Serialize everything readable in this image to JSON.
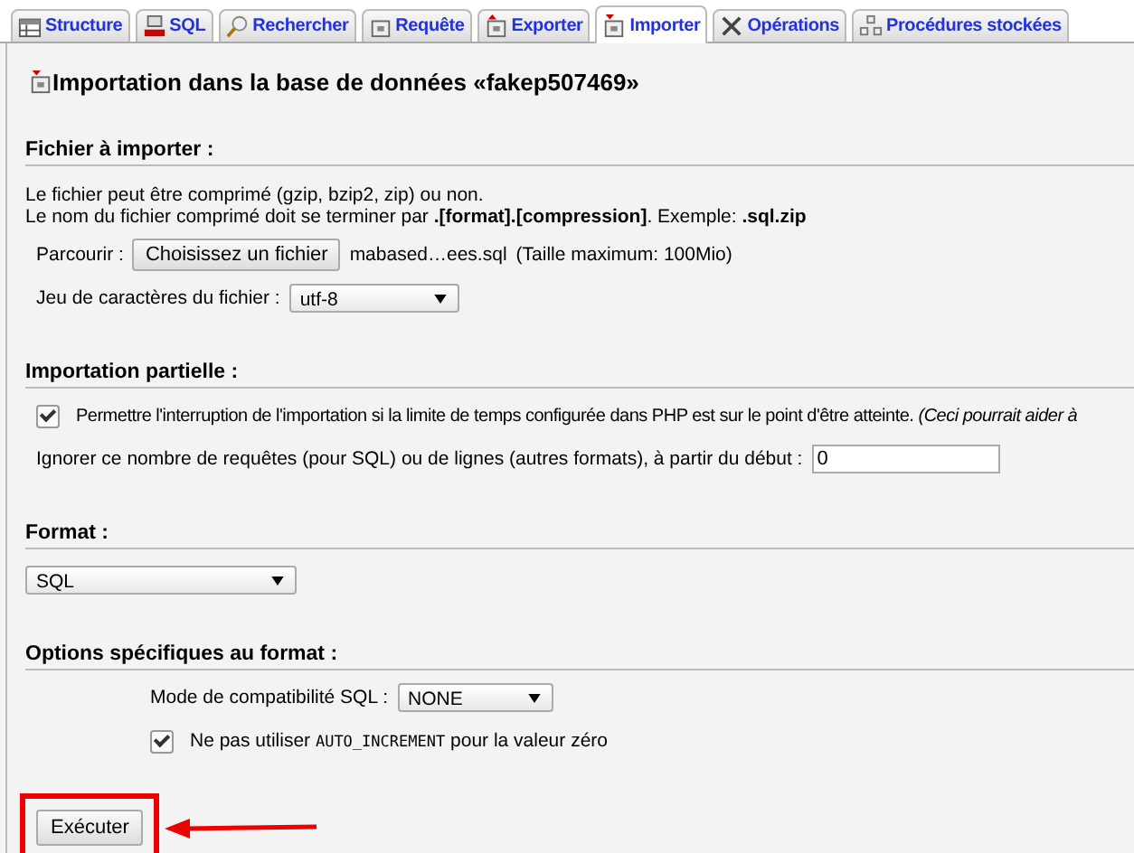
{
  "tabs": [
    {
      "label": "Structure",
      "selected": false
    },
    {
      "label": "SQL",
      "selected": false
    },
    {
      "label": "Rechercher",
      "selected": false
    },
    {
      "label": "Requête",
      "selected": false
    },
    {
      "label": "Exporter",
      "selected": false
    },
    {
      "label": "Importer",
      "selected": true
    },
    {
      "label": "Opérations",
      "selected": false
    },
    {
      "label": "Procédures stockées",
      "selected": false
    }
  ],
  "page_title": "Importation dans la base de données «fakep507469»",
  "file_section": {
    "heading": "Fichier à importer :",
    "notes": [
      "Le fichier peut être comprimé (gzip, bzip2, zip) ou non.",
      "Le nom du fichier comprimé doit se terminer par **.[format].[compression]**. Exemple: **.sql.zip**"
    ],
    "browse_label": "Parcourir :",
    "browse_button": "Choisissez un fichier",
    "file_name": "mabased…ees.sql",
    "max_size": "(Taille maximum: 100Mio)",
    "charset_label": "Jeu de caractères du fichier :",
    "charset_value": "utf-8"
  },
  "partial_section": {
    "heading": "Importation partielle :",
    "allow_interrupt": {
      "label": "Permettre l'interruption de l'importation si la limite de temps configurée dans PHP est sur le point d'être atteinte. *(Ceci pourrait aider à*",
      "checked": true
    },
    "skip_label": "Ignorer ce nombre de requêtes (pour SQL) ou de lignes (autres formats), à partir du début :",
    "skip_value": "0"
  },
  "format_section": {
    "heading": "Format :",
    "value": "SQL"
  },
  "options_section": {
    "heading": "Options spécifiques au format :",
    "compat_label": "Mode de compatibilité SQL :",
    "compat_value": "NONE",
    "no_auto_increment": {
      "label_before": "Ne pas utiliser",
      "code": "AUTO_INCREMENT",
      "label_after": "pour la valeur zéro",
      "checked": true
    }
  },
  "submit_button": "Exécuter",
  "annotation": {
    "highlight": true
  }
}
